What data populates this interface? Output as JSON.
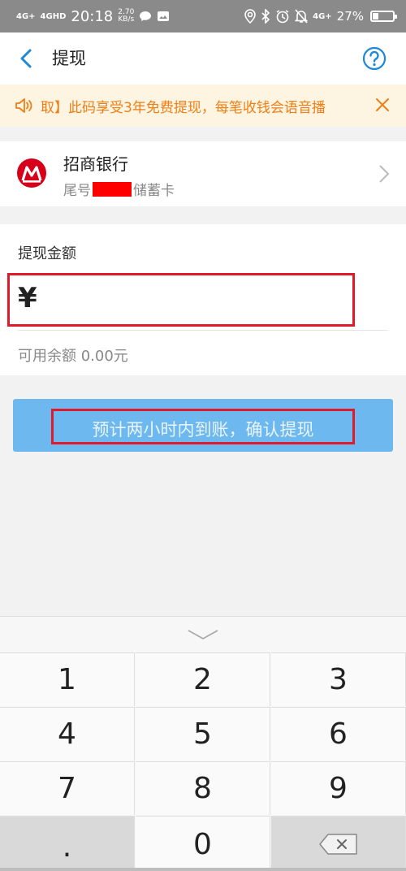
{
  "status_bar": {
    "signal1": "4G+",
    "signal2": "4GHD",
    "time": "20:18",
    "speed_value": "2.70",
    "speed_unit": "KB/s",
    "network": "4G+",
    "battery_text": "27%",
    "battery_level": 0.27
  },
  "header": {
    "title": "提现",
    "help_icon": "question-circle-icon"
  },
  "notice": {
    "text": "取】此码享受3年免费提现，每笔收钱会语音播",
    "color": "#f07e15"
  },
  "bank": {
    "name": "招商银行",
    "tail_prefix": "尾号",
    "card_type": "储蓄卡"
  },
  "amount": {
    "label": "提现金额",
    "currency": "¥",
    "value": "",
    "available": "可用余额 0.00元"
  },
  "confirm": {
    "label": "预计两小时内到账，确认提现",
    "color": "#6cb8ef"
  },
  "keypad": {
    "keys": [
      "1",
      "2",
      "3",
      "4",
      "5",
      "6",
      "7",
      "8",
      "9",
      ".",
      "0"
    ]
  }
}
